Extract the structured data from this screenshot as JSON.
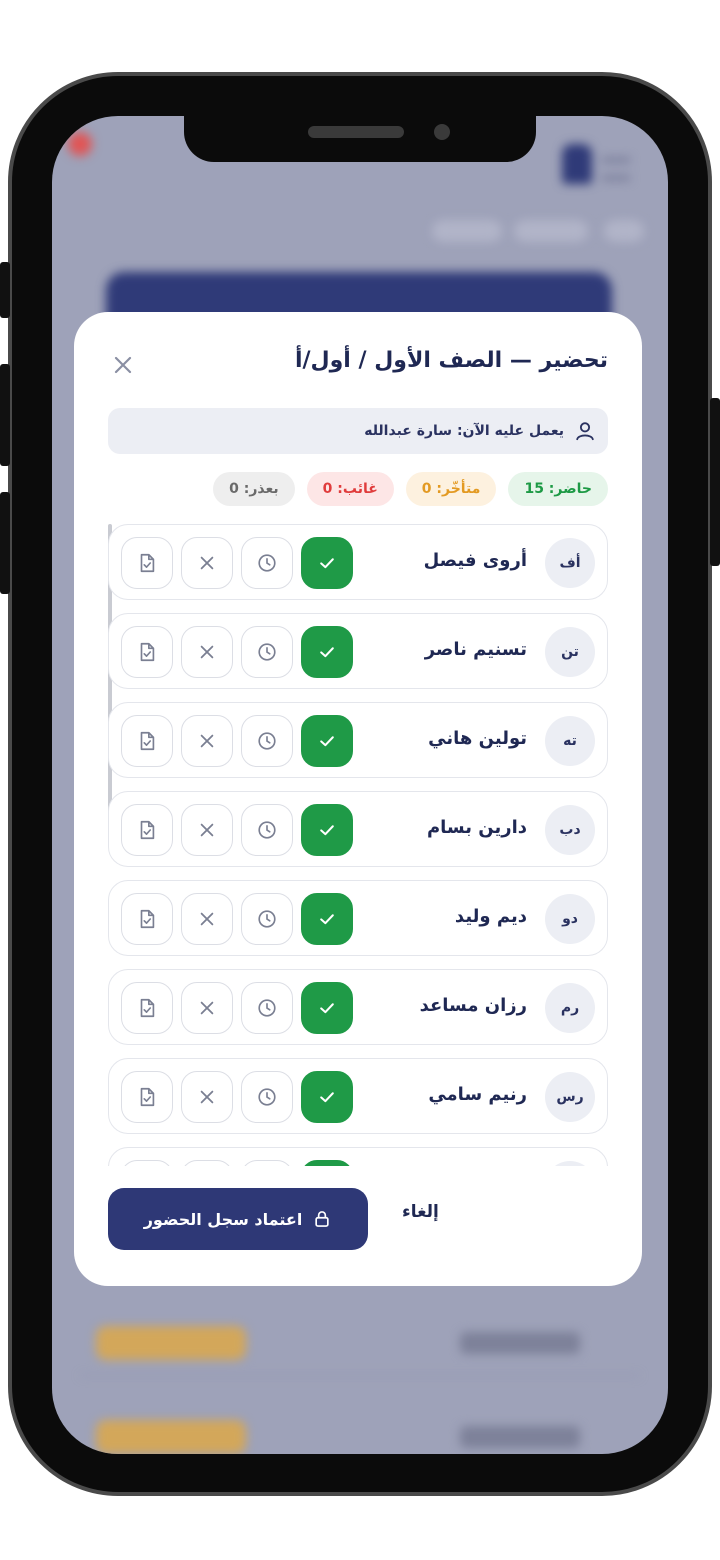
{
  "modal": {
    "title": "تحضير — الصف الأول / أول/أ",
    "worker_label": "يعمل عليه الآن: سارة عبدالله",
    "stats": {
      "present": "حاضر: 15",
      "late": "متأخّر: 0",
      "absent": "غائب: 0",
      "excused": "بعذر: 0"
    },
    "students": [
      {
        "initials": "أف",
        "name": "أروى فيصل",
        "status": "present"
      },
      {
        "initials": "تن",
        "name": "تسنيم ناصر",
        "status": "present"
      },
      {
        "initials": "ته",
        "name": "تولين هاني",
        "status": "present"
      },
      {
        "initials": "دب",
        "name": "دارين بسام",
        "status": "present"
      },
      {
        "initials": "دو",
        "name": "ديم وليد",
        "status": "present"
      },
      {
        "initials": "رم",
        "name": "رزان مساعد",
        "status": "present"
      },
      {
        "initials": "رس",
        "name": "رنيم سامي",
        "status": "present"
      },
      {
        "initials": "",
        "name": "",
        "status": "present"
      }
    ],
    "confirm_label": "اعتماد سجل الحضور",
    "cancel_label": "إلغاء"
  },
  "colors": {
    "primary": "#2e3876",
    "present": "#1f9a47",
    "late": "#e39a22",
    "absent": "#e03c3c",
    "excused": "#6a6a6a"
  },
  "icons": {
    "close": "close-icon",
    "user": "user-icon",
    "present": "check-icon",
    "late": "clock-icon",
    "absent": "x-icon",
    "excused": "document-check-icon",
    "lock": "lock-icon"
  }
}
